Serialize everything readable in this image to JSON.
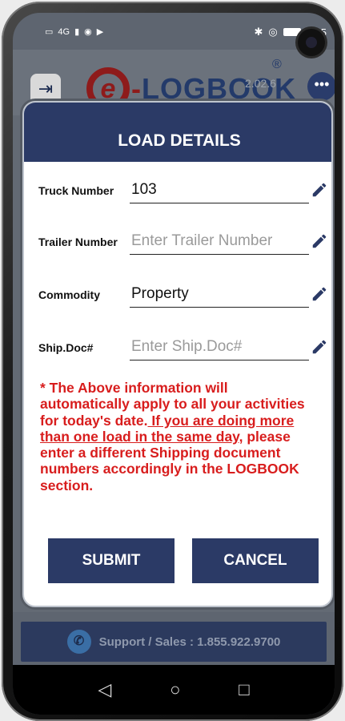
{
  "status_bar": {
    "left_icons": [
      "sim-icon",
      "signal-icon",
      "wifi-icon",
      "media-icon"
    ],
    "network": "4G",
    "time": "5:55"
  },
  "app": {
    "logo_letter": "e",
    "logo_dash": "-",
    "logo_word": "LOGBOOK",
    "registered": "®",
    "version": "2.02.6"
  },
  "modal": {
    "title": "LOAD DETAILS",
    "fields": [
      {
        "label": "Truck Number",
        "value": "103",
        "placeholder": ""
      },
      {
        "label": "Trailer Number",
        "value": "",
        "placeholder": "Enter Trailer Number"
      },
      {
        "label": "Commodity",
        "value": "Property",
        "placeholder": ""
      },
      {
        "label": "Ship.Doc#",
        "value": "",
        "placeholder": "Enter Ship.Doc#"
      }
    ],
    "notice_part1": "* The Above information will automatically apply to all your activities for today's date.",
    "notice_underlined": " If you are doing more than one load in the same day",
    "notice_part2": ", please enter a different Shipping document numbers accordingly in the LOGBOOK section.",
    "submit_label": "SUBMIT",
    "cancel_label": "CANCEL"
  },
  "support": {
    "text": "Support / Sales : 1.855.922.9700"
  },
  "navbar": {
    "back": "◁",
    "home": "○",
    "recents": "□"
  },
  "colors": {
    "primary": "#2b3a66",
    "notice": "#d81d1d",
    "logo_red": "#8e1b1b"
  }
}
